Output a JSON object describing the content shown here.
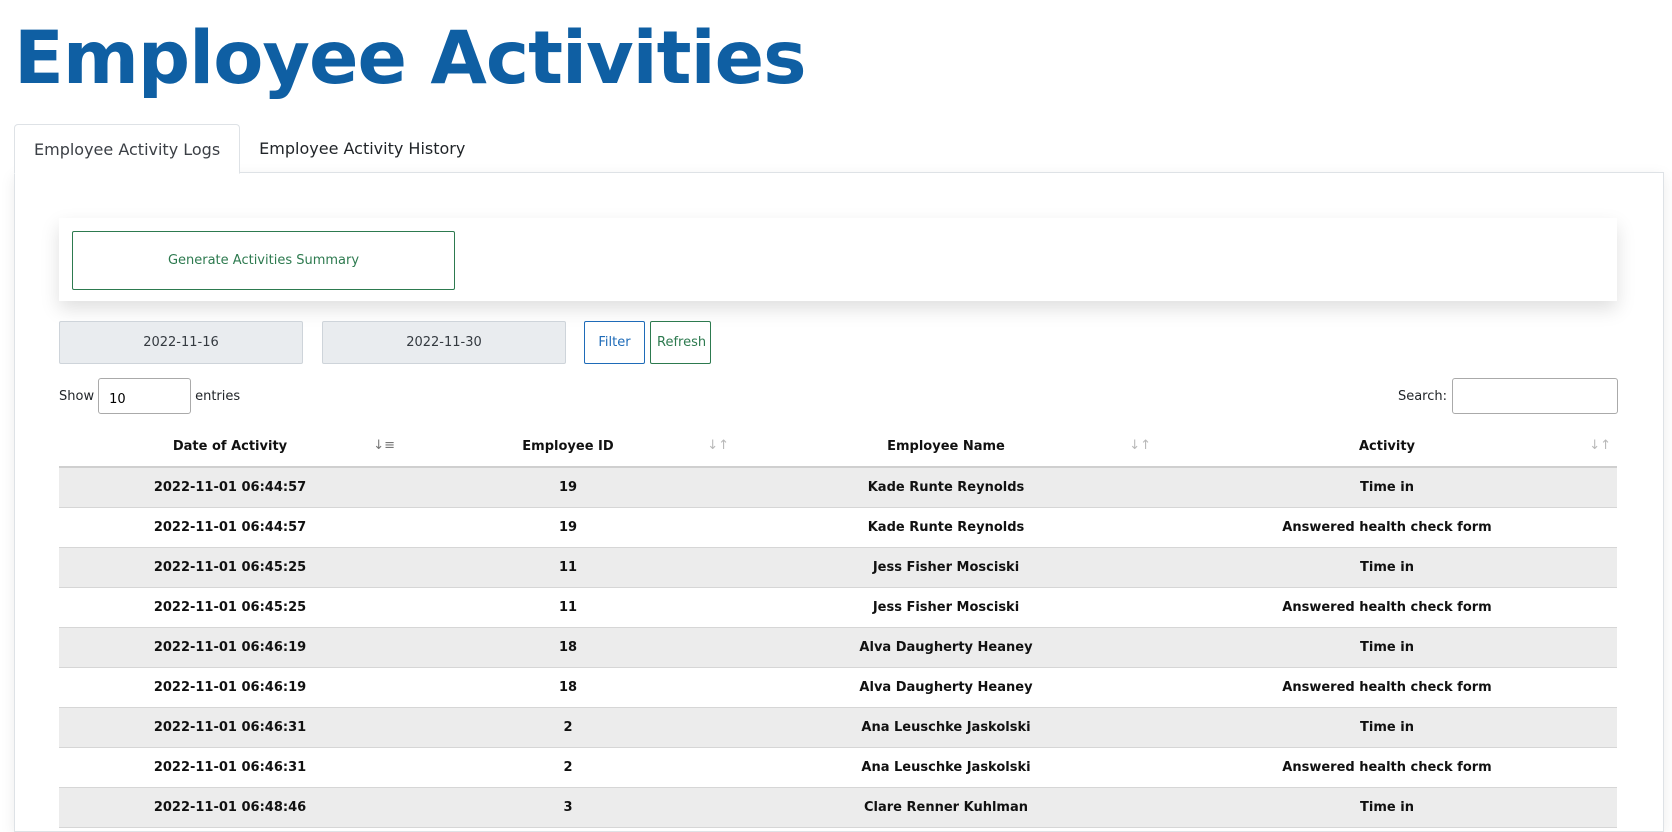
{
  "page": {
    "title": "Employee Activities"
  },
  "tabs": [
    {
      "label": "Employee Activity Logs",
      "active": true
    },
    {
      "label": "Employee Activity History",
      "active": false
    }
  ],
  "summary": {
    "button_label": "Generate Activities Summary"
  },
  "filters": {
    "date_from": "2022-11-16",
    "date_to": "2022-11-30",
    "filter_label": "Filter",
    "refresh_label": "Refresh"
  },
  "table_controls": {
    "show_label": "Show",
    "entries_value": "10",
    "entries_label": "entries",
    "search_label": "Search:",
    "search_value": ""
  },
  "table": {
    "columns": [
      "Date of Activity",
      "Employee ID",
      "Employee Name",
      "Activity"
    ],
    "sort_icons": [
      "sort-ascending-icon",
      "sort-icon",
      "sort-icon",
      "sort-icon"
    ],
    "rows": [
      [
        "2022-11-01 06:44:57",
        "19",
        "Kade Runte Reynolds",
        "Time in"
      ],
      [
        "2022-11-01 06:44:57",
        "19",
        "Kade Runte Reynolds",
        "Answered health check form"
      ],
      [
        "2022-11-01 06:45:25",
        "11",
        "Jess Fisher Mosciski",
        "Time in"
      ],
      [
        "2022-11-01 06:45:25",
        "11",
        "Jess Fisher Mosciski",
        "Answered health check form"
      ],
      [
        "2022-11-01 06:46:19",
        "18",
        "Alva Daugherty Heaney",
        "Time in"
      ],
      [
        "2022-11-01 06:46:19",
        "18",
        "Alva Daugherty Heaney",
        "Answered health check form"
      ],
      [
        "2022-11-01 06:46:31",
        "2",
        "Ana Leuschke Jaskolski",
        "Time in"
      ],
      [
        "2022-11-01 06:46:31",
        "2",
        "Ana Leuschke Jaskolski",
        "Answered health check form"
      ],
      [
        "2022-11-01 06:48:46",
        "3",
        "Clare Renner Kuhlman",
        "Time in"
      ]
    ]
  },
  "colors": {
    "title": "#0f5fa3",
    "success": "#2d7a4f",
    "primary": "#1e6bb8",
    "row_stripe": "#ececec"
  }
}
